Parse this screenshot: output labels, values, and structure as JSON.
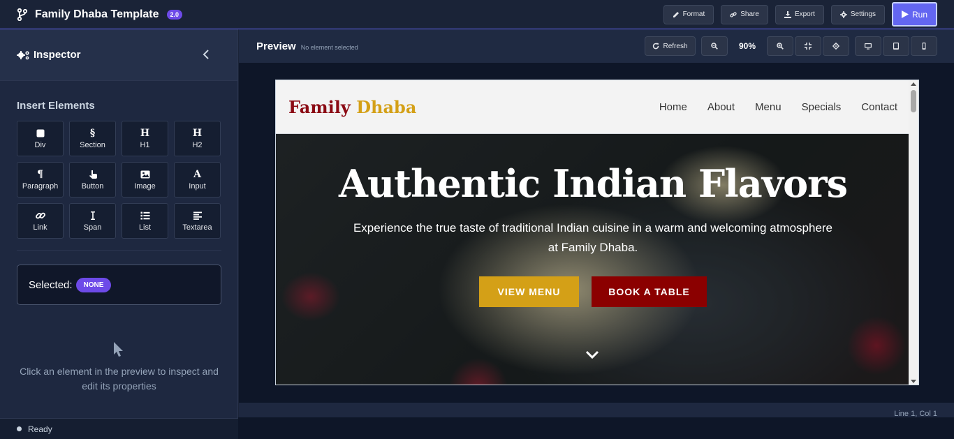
{
  "app": {
    "title": "Family Dhaba Template",
    "version": "2.0"
  },
  "toolbar": {
    "format_label": "Format",
    "share_label": "Share",
    "export_label": "Export",
    "settings_label": "Settings",
    "run_label": "Run"
  },
  "inspector": {
    "title": "Inspector",
    "insert_title": "Insert Elements",
    "elements": [
      {
        "label": "Div",
        "icon": "square-icon"
      },
      {
        "label": "Section",
        "icon": "section-icon"
      },
      {
        "label": "H1",
        "icon": "heading-icon"
      },
      {
        "label": "H2",
        "icon": "heading-icon"
      },
      {
        "label": "Paragraph",
        "icon": "paragraph-icon"
      },
      {
        "label": "Button",
        "icon": "hand-pointer-icon"
      },
      {
        "label": "Image",
        "icon": "image-icon"
      },
      {
        "label": "Input",
        "icon": "font-icon"
      },
      {
        "label": "Link",
        "icon": "link-icon"
      },
      {
        "label": "Span",
        "icon": "text-cursor-icon"
      },
      {
        "label": "List",
        "icon": "list-icon"
      },
      {
        "label": "Textarea",
        "icon": "align-left-icon"
      }
    ],
    "selected_label": "Selected:",
    "selected_value": "NONE",
    "hint": "Click an element in the preview to inspect and edit its properties"
  },
  "status": {
    "text": "Ready",
    "line_info": "Line 1, Col 1"
  },
  "preview": {
    "title": "Preview",
    "subtitle": "No element selected",
    "refresh_label": "Refresh",
    "zoom": "90%"
  },
  "site": {
    "logo_part1": "Family",
    "logo_part2": "Dhaba",
    "nav": [
      "Home",
      "About",
      "Menu",
      "Specials",
      "Contact"
    ],
    "hero_title": "Authentic Indian Flavors",
    "hero_subtitle": "Experience the true taste of traditional Indian cuisine in a warm and welcoming atmosphere at Family Dhaba.",
    "btn_menu": "VIEW MENU",
    "btn_book": "BOOK A TABLE"
  },
  "colors": {
    "accent": "#6366f1",
    "badge": "#6d4ae8",
    "brand_red": "#8b0a14",
    "brand_gold": "#d4a017"
  }
}
